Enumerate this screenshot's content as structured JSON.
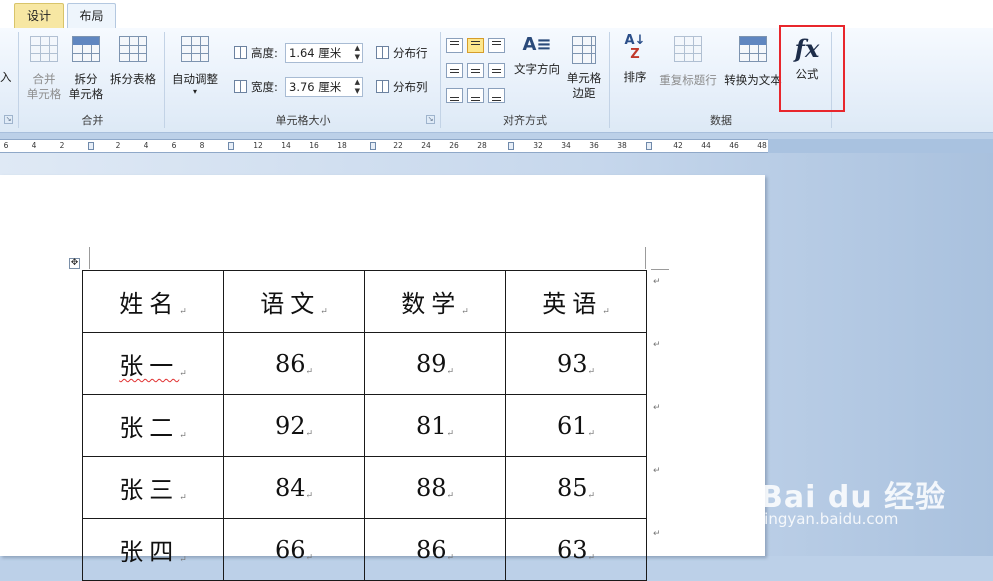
{
  "tabs": [
    {
      "label": "设计"
    },
    {
      "label": "布局"
    }
  ],
  "ribbon": {
    "left_cut_label": "入",
    "merge_group": {
      "label": "合并",
      "merge_cells": {
        "line1": "合并",
        "line2": "单元格"
      },
      "split_cells": {
        "line1": "拆分",
        "line2": "单元格"
      },
      "split_table": {
        "label": "拆分表格"
      }
    },
    "cell_size_group": {
      "label": "单元格大小",
      "autofit": {
        "label": "自动调整",
        "arrow": "▾"
      },
      "height_label": "高度:",
      "height_value": "1.64 厘米",
      "width_label": "宽度:",
      "width_value": "3.76 厘米",
      "distribute_rows": "分布行",
      "distribute_cols": "分布列"
    },
    "alignment_group": {
      "label": "对齐方式",
      "text_direction": {
        "label": "文字方向"
      },
      "cell_margins": {
        "line1": "单元格",
        "line2": "边距"
      }
    },
    "data_group": {
      "label": "数据",
      "sort": {
        "label": "排序"
      },
      "repeat_header": {
        "label": "重复标题行"
      },
      "convert_to_text": {
        "label": "转换为文本"
      },
      "formula": {
        "label": "公式",
        "icon_text": "fx"
      }
    }
  },
  "ruler": {
    "ticks": [
      "6",
      "4",
      "2",
      "2",
      "4",
      "6",
      "8",
      "12",
      "14",
      "16",
      "18",
      "22",
      "24",
      "26",
      "28",
      "32",
      "34",
      "36",
      "38",
      "42",
      "44",
      "46",
      "48"
    ]
  },
  "table": {
    "headers": [
      "姓名",
      "语文",
      "数学",
      "英语"
    ],
    "rows": [
      [
        "张一",
        "86",
        "89",
        "93"
      ],
      [
        "张二",
        "92",
        "81",
        "61"
      ],
      [
        "张三",
        "84",
        "88",
        "85"
      ],
      [
        "张四",
        "66",
        "86",
        "63"
      ]
    ],
    "cell_mark": "↵"
  },
  "watermark": {
    "logo": "Bai du 经验",
    "url": "jingyan.baidu.com"
  }
}
